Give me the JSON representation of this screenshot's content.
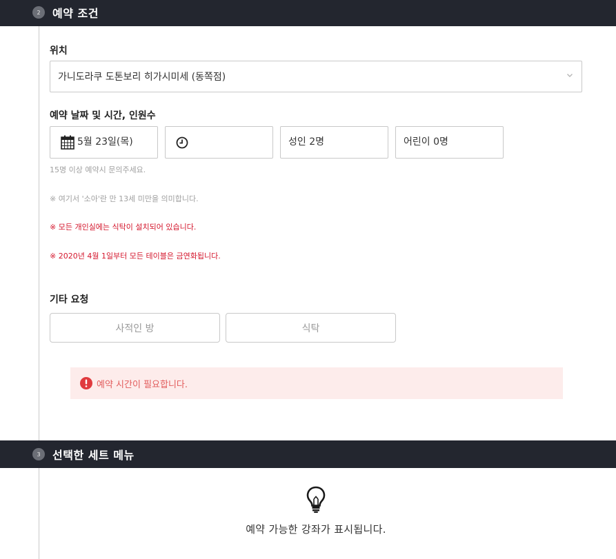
{
  "section1": {
    "step": "2",
    "title": "예약 조건"
  },
  "location": {
    "label": "위치",
    "selected": "가니도라쿠 도톤보리 히가시미세 (동쪽점)"
  },
  "datetime": {
    "label": "예약 날짜 및 시간, 인원수",
    "date": "5월 23일(목)",
    "time": "",
    "adults": "성인 2명",
    "children": "어린이 0명"
  },
  "notes": {
    "group": "15명 이상 예약시 문의주세요.",
    "child_def": "※ 여기서 '소아'란 만 13세 미만을 의미합니다.",
    "private_room": "※ 모든 개인실에는 식탁이 설치되어 있습니다.",
    "no_smoking": "※ 2020년 4월 1일부터 모든 테이블은 금연화됩니다."
  },
  "other_requests": {
    "label": "기타 요청",
    "options": [
      "사적인 방",
      "식탁"
    ]
  },
  "error": {
    "message": "예약 시간이 필요합니다."
  },
  "section2": {
    "step": "3",
    "title": "선택한 세트 메뉴"
  },
  "empty_state": {
    "icon": "lightbulb-icon",
    "message": "예약 가능한 강좌가 표시됩니다."
  },
  "colors": {
    "header_bg": "#23262f",
    "error_bg": "#fdeceb",
    "error_text": "#e25b5b",
    "notice_red": "#d4162c"
  }
}
